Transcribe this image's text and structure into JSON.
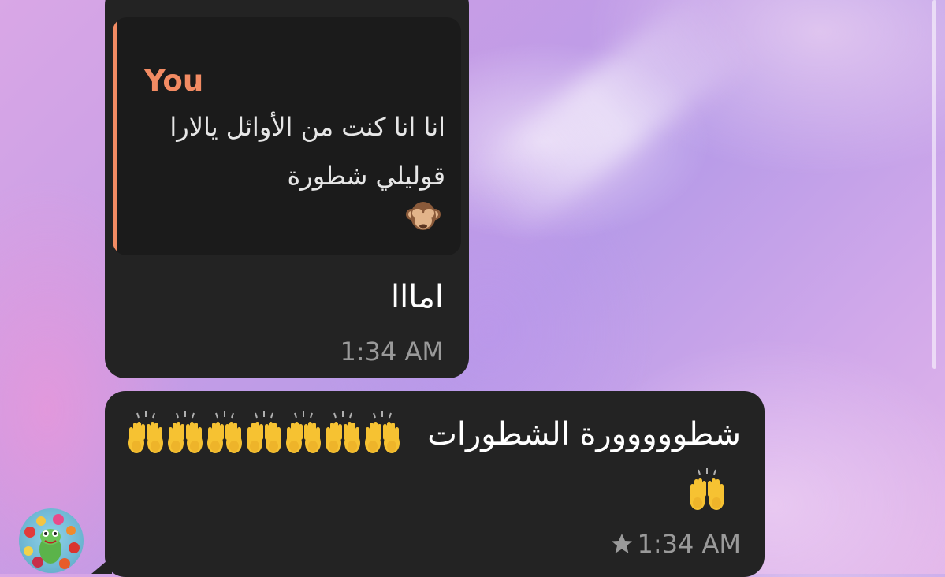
{
  "reply_quote": {
    "author": "You",
    "text_line1": "انا انا كنت من الأوائل يالارا",
    "text_line2": "قوليلي شطورة",
    "emoji": "see-no-evil-monkey"
  },
  "message1": {
    "text": "امااا",
    "time": "1:34 AM"
  },
  "message2": {
    "text": "شطووووورة الشطورات",
    "emoji": "raising-hands",
    "emoji_count_line1": 7,
    "emoji_count_line2": 1,
    "time": "1:34 AM",
    "starred": true
  },
  "colors": {
    "bubble": "#232323",
    "reply_accent": "#f28b63",
    "timestamp": "#9a9a9a"
  }
}
